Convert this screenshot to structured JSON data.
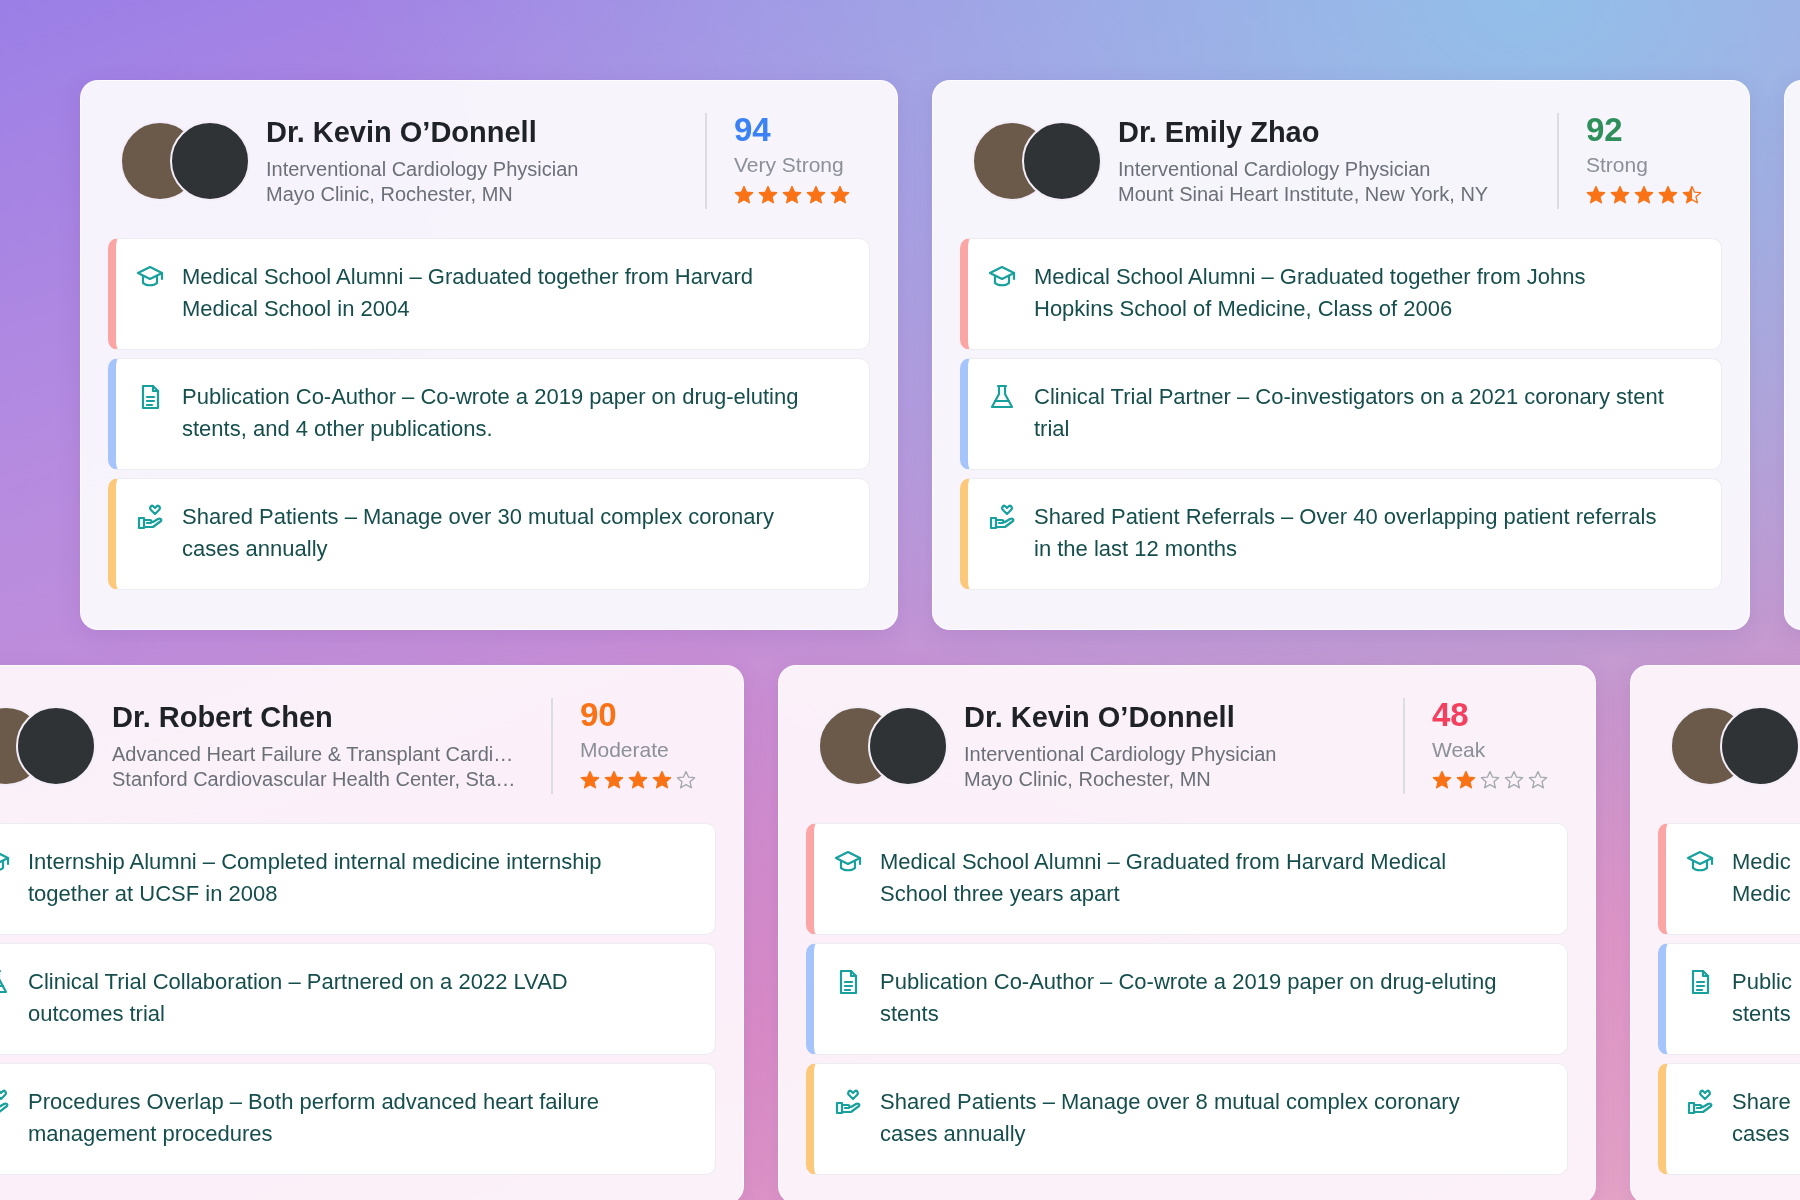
{
  "rows": [
    {
      "cards": [
        {
          "name": "Dr. Kevin O’Donnell",
          "specialty": "Interventional Cardiology Physician",
          "location": "Mayo Clinic, Rochester, MN",
          "score": "94",
          "color": "#3b82f6",
          "strength": "Very Strong",
          "stars": 5,
          "connections": [
            {
              "kind": "education",
              "color": "#fca5a5",
              "text": "Medical School Alumni – Graduated together from Harvard Medical School in 2004"
            },
            {
              "kind": "publication",
              "color": "#a5c4fb",
              "text": "Publication Co-Author – Co-wrote a 2019 paper on drug-eluting stents, and 4 other publications."
            },
            {
              "kind": "patients",
              "color": "#fcc97a",
              "text": "Shared Patients – Manage over 30 mutual complex coronary cases annually"
            }
          ]
        },
        {
          "name": "Dr. Emily Zhao",
          "specialty": "Interventional Cardiology Physician",
          "location": "Mount Sinai Heart Institute, New York, NY",
          "score": "92",
          "color": "#2f8f5b",
          "strength": "Strong",
          "stars": 4.5,
          "connections": [
            {
              "kind": "education",
              "color": "#fca5a5",
              "text": "Medical School Alumni – Graduated together from Johns Hopkins School of Medicine, Class of 2006"
            },
            {
              "kind": "trial",
              "color": "#a5c4fb",
              "text": "Clinical Trial Partner – Co-investigators on a 2021 coronary stent trial"
            },
            {
              "kind": "patients",
              "color": "#fcc97a",
              "text": "Shared Patient Referrals – Over 40 overlapping patient referrals in the last 12 months"
            }
          ]
        }
      ]
    },
    {
      "cards": [
        {
          "name": "Dr. Robert Chen",
          "specialty": "Advanced Heart Failure & Transplant Cardi…",
          "location": "Stanford Cardiovascular Health Center, Sta…",
          "score": "90",
          "color": "#f97316",
          "strength": "Moderate",
          "stars": 4,
          "connections": [
            {
              "kind": "education",
              "text": "Internship Alumni – Completed internal medicine internship together at UCSF in 2008"
            },
            {
              "kind": "trial",
              "text": "Clinical Trial Collaboration – Partnered on a 2022 LVAD outcomes trial"
            },
            {
              "kind": "patients",
              "text": "Procedures Overlap – Both perform advanced heart failure management procedures"
            }
          ]
        },
        {
          "name": "Dr. Kevin O’Donnell",
          "specialty": "Interventional Cardiology Physician",
          "location": "Mayo Clinic, Rochester, MN",
          "score": "48",
          "color": "#f43f5e",
          "strength": "Weak",
          "stars": 2,
          "connections": [
            {
              "kind": "education",
              "color": "#fca5a5",
              "text": "Medical School Alumni – Graduated from Harvard Medical School three years apart"
            },
            {
              "kind": "publication",
              "color": "#a5c4fb",
              "text": "Publication Co-Author – Co-wrote a 2019 paper on drug-eluting stents"
            },
            {
              "kind": "patients",
              "color": "#fcc97a",
              "text": "Shared Patients – Manage over 8 mutual complex coronary cases annually"
            }
          ]
        },
        {
          "connections": [
            {
              "kind": "education",
              "color": "#fca5a5",
              "text": "Medic\nMedic"
            },
            {
              "kind": "publication",
              "color": "#a5c4fb",
              "text": "Public\nstents"
            },
            {
              "kind": "patients",
              "color": "#fcc97a",
              "text": "Share\ncases"
            }
          ]
        }
      ]
    }
  ]
}
